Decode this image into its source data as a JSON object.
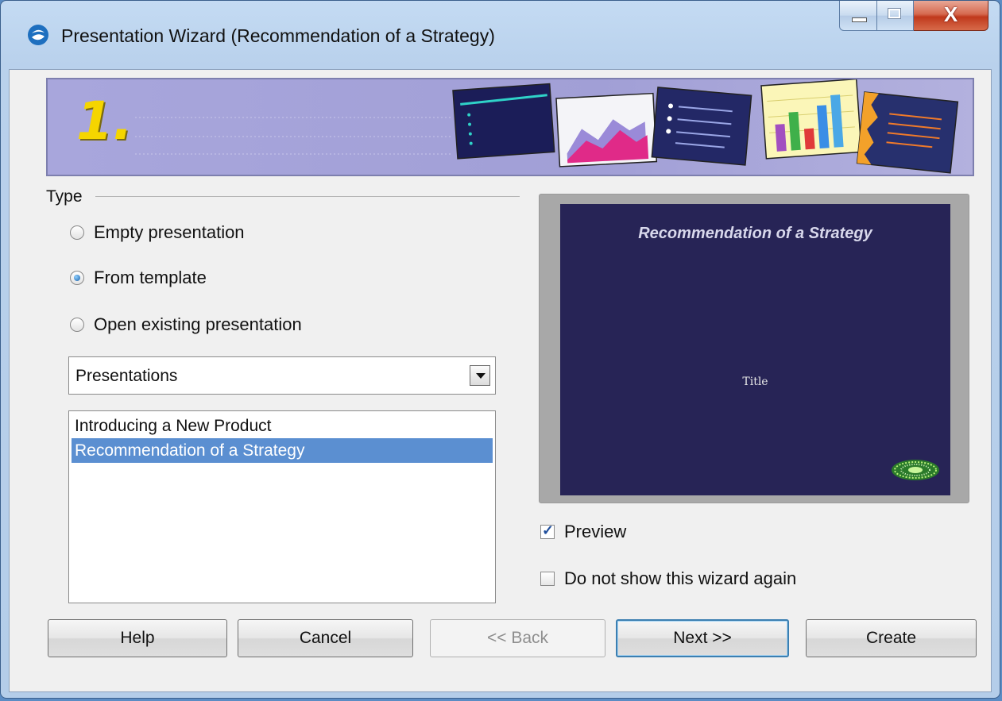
{
  "window": {
    "title": "Presentation Wizard (Recommendation of a Strategy)",
    "close_glyph": "X"
  },
  "banner": {
    "step_number": "1."
  },
  "type_group": {
    "label": "Type",
    "options": [
      {
        "label": "Empty presentation",
        "checked": false
      },
      {
        "label": "From template",
        "checked": true
      },
      {
        "label": "Open existing presentation",
        "checked": false
      }
    ]
  },
  "category_select": {
    "value": "Presentations"
  },
  "template_list": {
    "items": [
      {
        "label": "Introducing a New Product",
        "selected": false
      },
      {
        "label": "Recommendation of a Strategy",
        "selected": true
      }
    ]
  },
  "preview": {
    "slide_title": "Recommendation of a Strategy",
    "slide_subtitle": "Title",
    "background_color": "#272456"
  },
  "options": {
    "preview_label": "Preview",
    "preview_checked": true,
    "dont_show_label": "Do not show this wizard again",
    "dont_show_checked": false
  },
  "buttons": {
    "help": "Help",
    "cancel": "Cancel",
    "back": "<< Back",
    "next": "Next >>",
    "create": "Create"
  },
  "icons": {
    "app": "app-logo-icon",
    "minimize": "minimize-icon",
    "maximize": "maximize-icon",
    "close": "close-icon",
    "dropdown": "chevron-down-icon"
  },
  "colors": {
    "selection": "#5b8fd1",
    "banner": "#a8a6dc",
    "banner_number": "#f5d500",
    "close_button": "#c0391c"
  }
}
